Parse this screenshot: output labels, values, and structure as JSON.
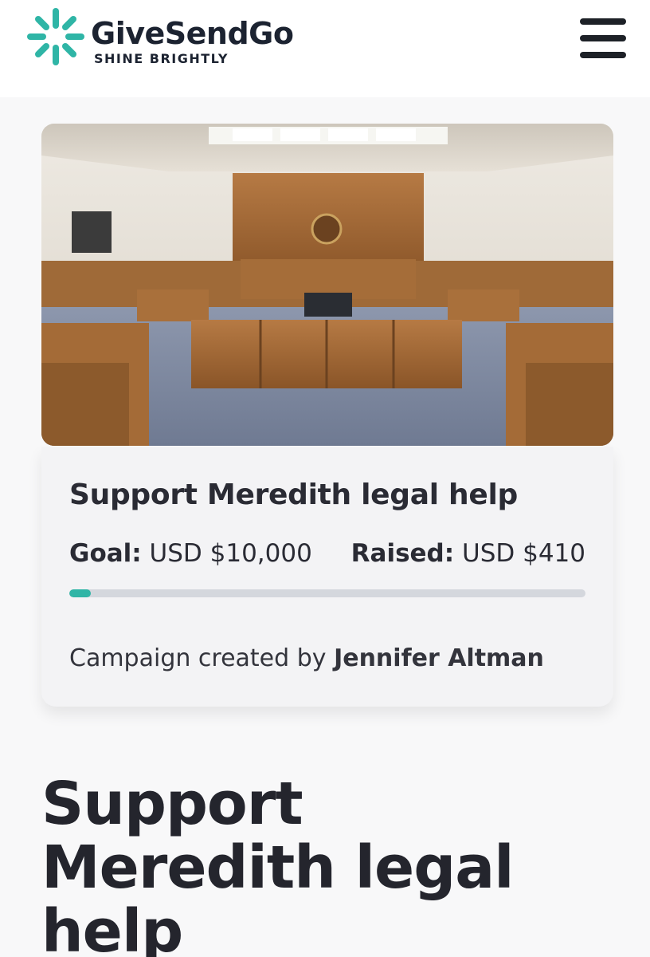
{
  "header": {
    "brand_name": "GiveSendGo",
    "tagline": "SHINE BRIGHTLY",
    "logo_icon": "starburst-logo-icon",
    "menu_icon": "hamburger-menu-icon",
    "accent_color": "#2fb5a6",
    "brand_text_color": "#1c2331"
  },
  "campaign": {
    "image_alt": "Courtroom interior",
    "title": "Support Meredith legal help",
    "goal_label": "Goal:",
    "goal_value": "USD $10,000",
    "raised_label": "Raised:",
    "raised_value": "USD $410",
    "progress_fraction": 0.041,
    "progress_color": "#2fb5a6",
    "creator_prefix": "Campaign created by",
    "creator_name": "Jennifer Altman"
  },
  "main": {
    "heading": "Support Meredith legal help"
  }
}
